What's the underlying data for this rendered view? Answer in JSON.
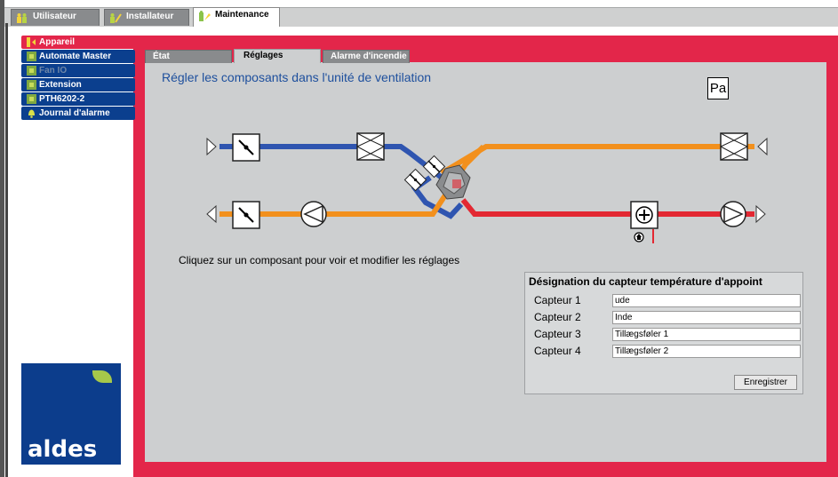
{
  "top_tabs": [
    {
      "label": "Utilisateur",
      "icon": "users-icon"
    },
    {
      "label": "Installateur",
      "icon": "installer-icon"
    },
    {
      "label": "Maintenance",
      "icon": "maintenance-icon",
      "active": true
    }
  ],
  "sidebar": {
    "items": [
      {
        "label": "Appareil",
        "icon": "device-icon",
        "active": true
      },
      {
        "label": "Automate Master",
        "icon": "controller-icon"
      },
      {
        "label": "Fan IO",
        "icon": "controller-icon",
        "disabled": true
      },
      {
        "label": "Extension",
        "icon": "controller-icon"
      },
      {
        "label": "PTH6202-2",
        "icon": "controller-icon"
      },
      {
        "label": "Journal d'alarme",
        "icon": "bell-icon"
      }
    ]
  },
  "logo": {
    "text": "aldes"
  },
  "sub_tabs": [
    {
      "label": "État"
    },
    {
      "label": "Réglages",
      "active": true
    },
    {
      "label": "Alarme d'incendie"
    }
  ],
  "main": {
    "heading": "Régler les composants dans l'unité de ventilation",
    "pa_button": "Pa",
    "hint": "Cliquez sur un composant pour voir et modifier les réglages"
  },
  "sensor_panel": {
    "title": "Désignation du capteur température d'appoint",
    "sensors": [
      {
        "label": "Capteur 1",
        "value": "ude"
      },
      {
        "label": "Capteur 2",
        "value": "Inde"
      },
      {
        "label": "Capteur 3",
        "value": "Tillægsføler 1"
      },
      {
        "label": "Capteur 4",
        "value": "Tillægsføler 2"
      }
    ],
    "save_label": "Enregistrer"
  },
  "colors": {
    "accent_red": "#e3264a",
    "nav_blue": "#0b3f8e",
    "duct_blue": "#2f55b0",
    "duct_orange": "#f2901d",
    "duct_red": "#e32832",
    "heading_blue": "#1d4f9d"
  }
}
